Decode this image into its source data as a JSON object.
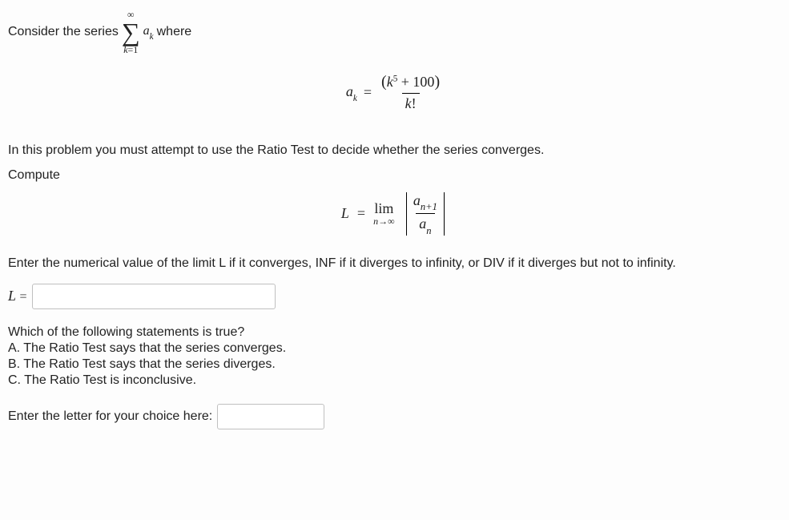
{
  "intro": {
    "prefix": "Consider the series",
    "sum_top": "∞",
    "sum_bottom_var": "k",
    "sum_bottom_eq": "=1",
    "term_a": "a",
    "term_sub": "k",
    "suffix": "where"
  },
  "formula": {
    "lhs_a": "a",
    "lhs_sub": "k",
    "eq": "=",
    "num_open": "(",
    "num_var": "k",
    "num_exp": "5",
    "num_plus": " + 100",
    "num_close": ")",
    "den_var": "k",
    "den_fact": "!"
  },
  "instruction": "In this problem you must attempt to use the Ratio Test to decide whether the series converges.",
  "compute_label": "Compute",
  "limit": {
    "L": "L",
    "eq": "=",
    "lim": "lim",
    "n": "n",
    "arrow": "→∞",
    "a": "a",
    "np1": "n+1",
    "ns": "n"
  },
  "enter_limit_instruction": "Enter the numerical value of the limit L if it converges, INF if it diverges to infinity, or DIV if it diverges but not to infinity.",
  "L_label": "L",
  "L_eq": "=",
  "mc": {
    "question": "Which of the following statements is true?",
    "A": "A. The Ratio Test says that the series converges.",
    "B": "B. The Ratio Test says that the series diverges.",
    "C": "C. The Ratio Test is inconclusive."
  },
  "choice_prompt": "Enter the letter for your choice here:"
}
